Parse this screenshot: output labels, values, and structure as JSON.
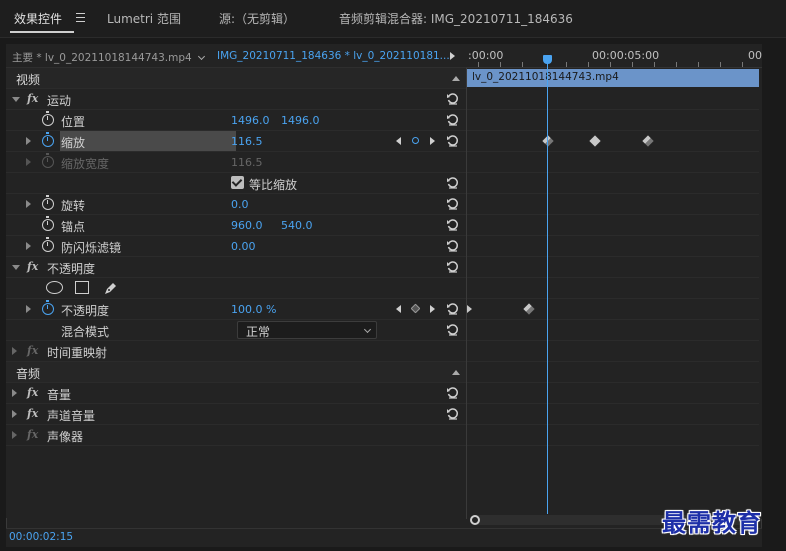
{
  "tabs": [
    {
      "label": "效果控件",
      "active": true
    },
    {
      "label": "Lumetri 范围",
      "active": false
    },
    {
      "label": "源:（无剪辑）",
      "active": false
    },
    {
      "label": "音频剪辑混合器: IMG_20210711_184636",
      "active": false
    }
  ],
  "clip_selector": {
    "master": "主要 * lv_0_20211018144743.mp4",
    "sequence": "IMG_20210711_184636 * lv_0_202110181..."
  },
  "ruler": {
    "start": ":00:00",
    "mid": "00:00:05:00",
    "end": "00"
  },
  "clip_bar_name": "lv_0_20211018144743.mp4",
  "sections": {
    "video": "视频",
    "audio": "音频"
  },
  "motion": {
    "title": "运动",
    "fx": "fx",
    "position": {
      "label": "位置",
      "x": "1496.0",
      "y": "1496.0"
    },
    "scale": {
      "label": "缩放",
      "value": "116.5"
    },
    "scale_width": {
      "label": "缩放宽度",
      "value": "116.5"
    },
    "uniform_scale": {
      "label": "等比缩放",
      "checked": true
    },
    "rotation": {
      "label": "旋转",
      "value": "0.0"
    },
    "anchor": {
      "label": "锚点",
      "x": "960.0",
      "y": "540.0"
    },
    "anti_flicker": {
      "label": "防闪烁滤镜",
      "value": "0.00"
    }
  },
  "opacity": {
    "title": "不透明度",
    "fx": "fx",
    "opacity": {
      "label": "不透明度",
      "value": "100.0 %"
    },
    "blend_mode": {
      "label": "混合模式",
      "value": "正常"
    }
  },
  "time_remap": {
    "title": "时间重映射",
    "fx": "fx"
  },
  "audio_effects": [
    {
      "fx": "fx",
      "title": "音量"
    },
    {
      "fx": "fx",
      "title": "声道音量"
    },
    {
      "fx": "fx",
      "title": "声像器"
    }
  ],
  "keyframes": {
    "scale_times": [
      "playhead",
      "00:00:04:00",
      "00:00:06:00"
    ],
    "opacity_times": [
      "start",
      "00:00:02:00"
    ]
  },
  "timecode": "00:00:02:15",
  "watermark": "最需教育",
  "colors": {
    "accent": "#4aa3f0",
    "clip_bar": "#6b94c9",
    "panel": "#232323"
  }
}
